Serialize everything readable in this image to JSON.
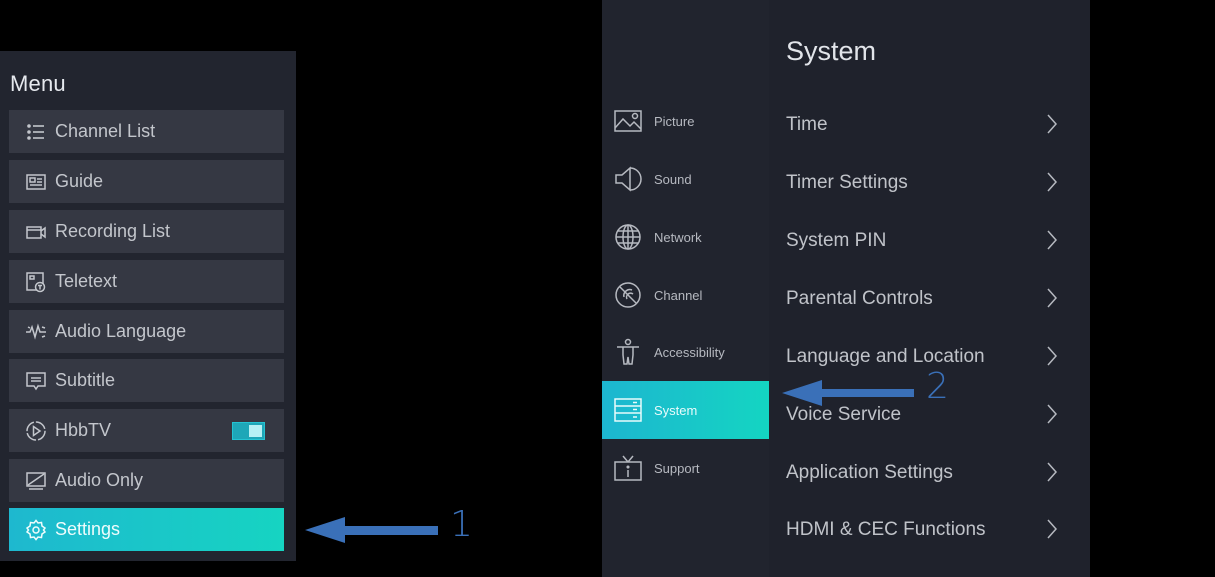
{
  "menu": {
    "title": "Menu",
    "items": [
      {
        "label": "Channel List",
        "icon": "list-icon"
      },
      {
        "label": "Guide",
        "icon": "guide-icon"
      },
      {
        "label": "Recording List",
        "icon": "recording-icon"
      },
      {
        "label": "Teletext",
        "icon": "teletext-icon"
      },
      {
        "label": "Audio Language",
        "icon": "audio-language-icon"
      },
      {
        "label": "Subtitle",
        "icon": "subtitle-icon"
      },
      {
        "label": "HbbTV",
        "icon": "hbbtv-icon",
        "toggle": true,
        "toggle_on": true
      },
      {
        "label": "Audio Only",
        "icon": "audio-only-icon"
      },
      {
        "label": "Settings",
        "icon": "gear-icon",
        "active": true
      }
    ]
  },
  "annotations": {
    "step1": "1",
    "step2": "2",
    "arrow_color": "#3a70b8"
  },
  "settings": {
    "categories": [
      {
        "label": "Picture",
        "icon": "picture-icon"
      },
      {
        "label": "Sound",
        "icon": "sound-icon"
      },
      {
        "label": "Network",
        "icon": "globe-icon"
      },
      {
        "label": "Channel",
        "icon": "channel-icon"
      },
      {
        "label": "Accessibility",
        "icon": "accessibility-icon"
      },
      {
        "label": "System",
        "icon": "system-icon",
        "active": true
      },
      {
        "label": "Support",
        "icon": "support-icon"
      }
    ],
    "title": "System",
    "items": [
      {
        "label": "Time"
      },
      {
        "label": "Timer Settings"
      },
      {
        "label": "System PIN"
      },
      {
        "label": "Parental Controls"
      },
      {
        "label": "Language and Location"
      },
      {
        "label": "Voice Service"
      },
      {
        "label": "Application Settings"
      },
      {
        "label": "HDMI & CEC Functions"
      }
    ]
  },
  "colors": {
    "accent_start": "#1eb8cf",
    "accent_end": "#16d4c2",
    "panel_bg": "#22252f",
    "item_bg": "#353843"
  }
}
